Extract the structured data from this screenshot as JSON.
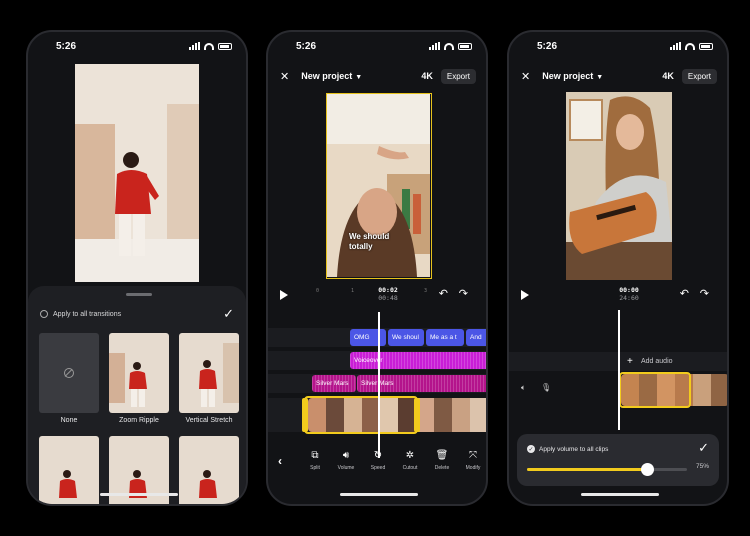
{
  "status": {
    "time": "5:26"
  },
  "transitions": {
    "apply_all": "Apply to all transitions",
    "tiles": [
      {
        "label": "None",
        "kind": "none"
      },
      {
        "label": "Zoom Ripple",
        "kind": "photo"
      },
      {
        "label": "Vertical Stretch",
        "kind": "photo"
      },
      {
        "label": "",
        "kind": "photo"
      },
      {
        "label": "",
        "kind": "photo"
      },
      {
        "label": "",
        "kind": "photo"
      }
    ]
  },
  "editor": {
    "title": "New project",
    "resolution": "4K",
    "export": "Export",
    "caption_line1": "We should",
    "caption_line2": "totally",
    "timecode": "00:02",
    "duration": "00:48",
    "ticks": [
      "0",
      "1",
      "3"
    ],
    "clips_top": [
      "OMG",
      "We shoul",
      "Me as a t",
      "And"
    ],
    "voiceover": "Voiceover",
    "music_1": "Silver Mars",
    "music_2": "Silver Mars",
    "tools": [
      "Split",
      "Volume",
      "Speed",
      "Cutout",
      "Delete",
      "Modify"
    ]
  },
  "volume": {
    "timecode": "00:00",
    "duration": "24:60",
    "add_audio": "Add audio",
    "apply_all": "Apply volume to all clips",
    "percent": "75%",
    "level": 0.75
  },
  "colors": {
    "accent": "#f2cb1d",
    "clip_blue": "#4b56e6",
    "clip_pink": "#c91ed6",
    "bg": "#121316"
  }
}
